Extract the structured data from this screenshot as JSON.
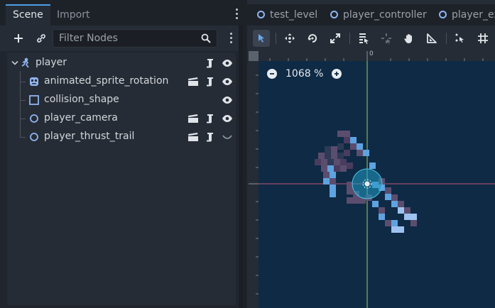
{
  "dock": {
    "tabs": [
      {
        "label": "Scene"
      },
      {
        "label": "Import"
      }
    ],
    "filter_placeholder": "Filter Nodes"
  },
  "tree": {
    "nodes": [
      {
        "label": "player",
        "icon": "character-body-icon",
        "actions": [
          "script-icon",
          "eye-icon"
        ]
      },
      {
        "label": "animated_sprite_rotation",
        "icon": "animated-sprite-icon",
        "actions": [
          "clapper-icon",
          "script-icon",
          "eye-icon"
        ]
      },
      {
        "label": "collision_shape",
        "icon": "collision-shape-icon",
        "actions": [
          "eye-icon"
        ]
      },
      {
        "label": "player_camera",
        "icon": "node-circle-icon",
        "actions": [
          "clapper-icon",
          "script-icon",
          "eye-icon"
        ]
      },
      {
        "label": "player_thrust_trail",
        "icon": "node-circle-icon",
        "actions": [
          "clapper-icon",
          "script-icon",
          "eye-closed-icon"
        ]
      }
    ]
  },
  "scene_tabs": [
    {
      "label": "test_level"
    },
    {
      "label": "player_controller"
    },
    {
      "label": "player_ex"
    }
  ],
  "editor": {
    "ruler_origin_label": "0",
    "zoom_label": "1068 %"
  },
  "colors": {
    "accent": "#4d9ee8",
    "viewport_bg": "#0e2a45",
    "tab_ring": "#8fb4f0"
  }
}
